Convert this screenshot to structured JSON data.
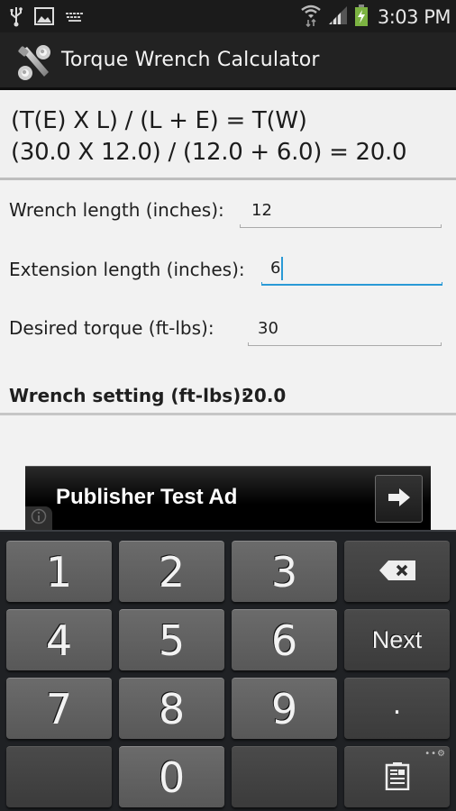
{
  "status_bar": {
    "left_icons": [
      "usb-icon",
      "image-icon",
      "keyboard-icon"
    ],
    "right_icons": [
      "wifi-icon",
      "signal-icon",
      "battery-charging-icon"
    ],
    "time": "3:03 PM",
    "battery_color": "#7cb342"
  },
  "app": {
    "title": "Torque Wrench Calculator",
    "icon": "wrench-bolt-icon"
  },
  "formula": {
    "line1": "(T(E) X L) / (L + E) = T(W)",
    "line2": "(30.0 X 12.0) / (12.0 + 6.0) = 20.0"
  },
  "form": {
    "wrench_length": {
      "label": "Wrench length (inches):",
      "value": "12"
    },
    "extension_length": {
      "label": "Extension length (inches):",
      "value": "6"
    },
    "desired_torque": {
      "label": "Desired torque (ft-lbs):",
      "value": "30"
    },
    "result": {
      "label": "Wrench setting (ft-lbs):",
      "value": "20.0"
    },
    "focus_color": "#2a9ad6"
  },
  "ad": {
    "text": "Publisher Test Ad",
    "arrow_icon": "arrow-right-icon",
    "info_icon": "info-icon"
  },
  "keyboard": {
    "rows": [
      [
        "1",
        "2",
        "3",
        "backspace"
      ],
      [
        "4",
        "5",
        "6",
        "Next"
      ],
      [
        "7",
        "8",
        "9",
        "."
      ],
      [
        "",
        "0",
        "",
        "clipboard"
      ]
    ],
    "keys": {
      "k1": "1",
      "k2": "2",
      "k3": "3",
      "k4": "4",
      "k5": "5",
      "k6": "6",
      "k7": "7",
      "k8": "8",
      "k9": "9",
      "k0": "0",
      "next": "Next",
      "dot": "."
    }
  }
}
